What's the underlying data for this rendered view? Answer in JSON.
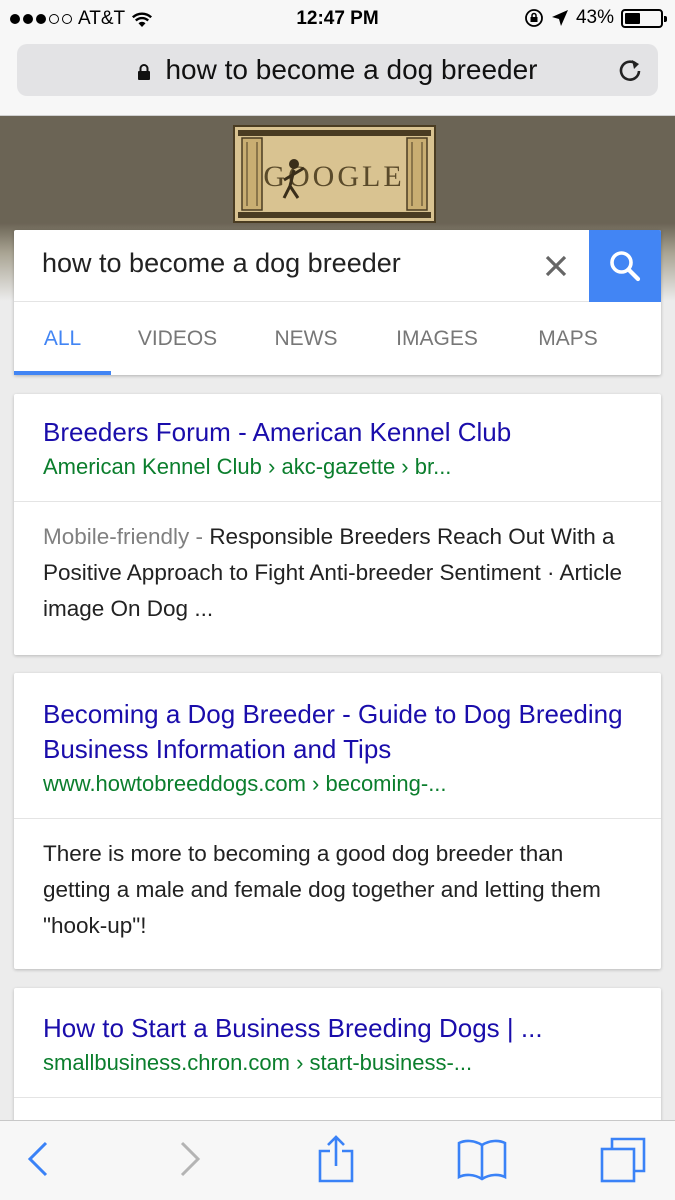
{
  "status_bar": {
    "carrier": "AT&T",
    "time": "12:47 PM",
    "battery_percent": "43%",
    "battery_level": 0.43,
    "signal_bars_filled": 3,
    "signal_bars_total": 5
  },
  "url_bar": {
    "address": "how to become a dog breeder",
    "icons": [
      "lock-icon",
      "reload-icon"
    ]
  },
  "doodle": {
    "text": "GOOGLE"
  },
  "search": {
    "query": "how to become a dog breeder",
    "tabs": [
      {
        "label": "ALL",
        "active": true
      },
      {
        "label": "VIDEOS",
        "active": false
      },
      {
        "label": "NEWS",
        "active": false
      },
      {
        "label": "IMAGES",
        "active": false
      },
      {
        "label": "MAPS",
        "active": false
      }
    ]
  },
  "results": [
    {
      "title": "Breeders Forum - American Kennel Club",
      "cite_domain": "American Kennel Club",
      "cite_path": " › akc-gazette › br...",
      "mobile_friendly": "Mobile-friendly - ",
      "snippet": "Responsible Breeders Reach Out With a Positive Approach to Fight Anti-breeder Sentiment · Article image On Dog ..."
    },
    {
      "title": "Becoming a Dog Breeder - Guide to Dog Breeding Business Information and Tips",
      "cite_domain": "www.howtobreeddogs.com",
      "cite_path": " › becoming-...",
      "snippet": "There is more to becoming a good dog breeder than getting a male and female dog together and letting them \"hook-up\"!"
    },
    {
      "title": "How to Start a Business Breeding Dogs | ...",
      "cite_domain": "smallbusiness.chron.com",
      "cite_path": " › start-business-..."
    }
  ],
  "toolbar": {
    "icons": [
      "back-icon",
      "forward-icon",
      "share-icon",
      "bookmarks-icon",
      "tabs-icon"
    ]
  },
  "colors": {
    "link_title": "#1a0dab",
    "cite_green": "#0b7e2d",
    "accent_blue": "#4285f4"
  }
}
